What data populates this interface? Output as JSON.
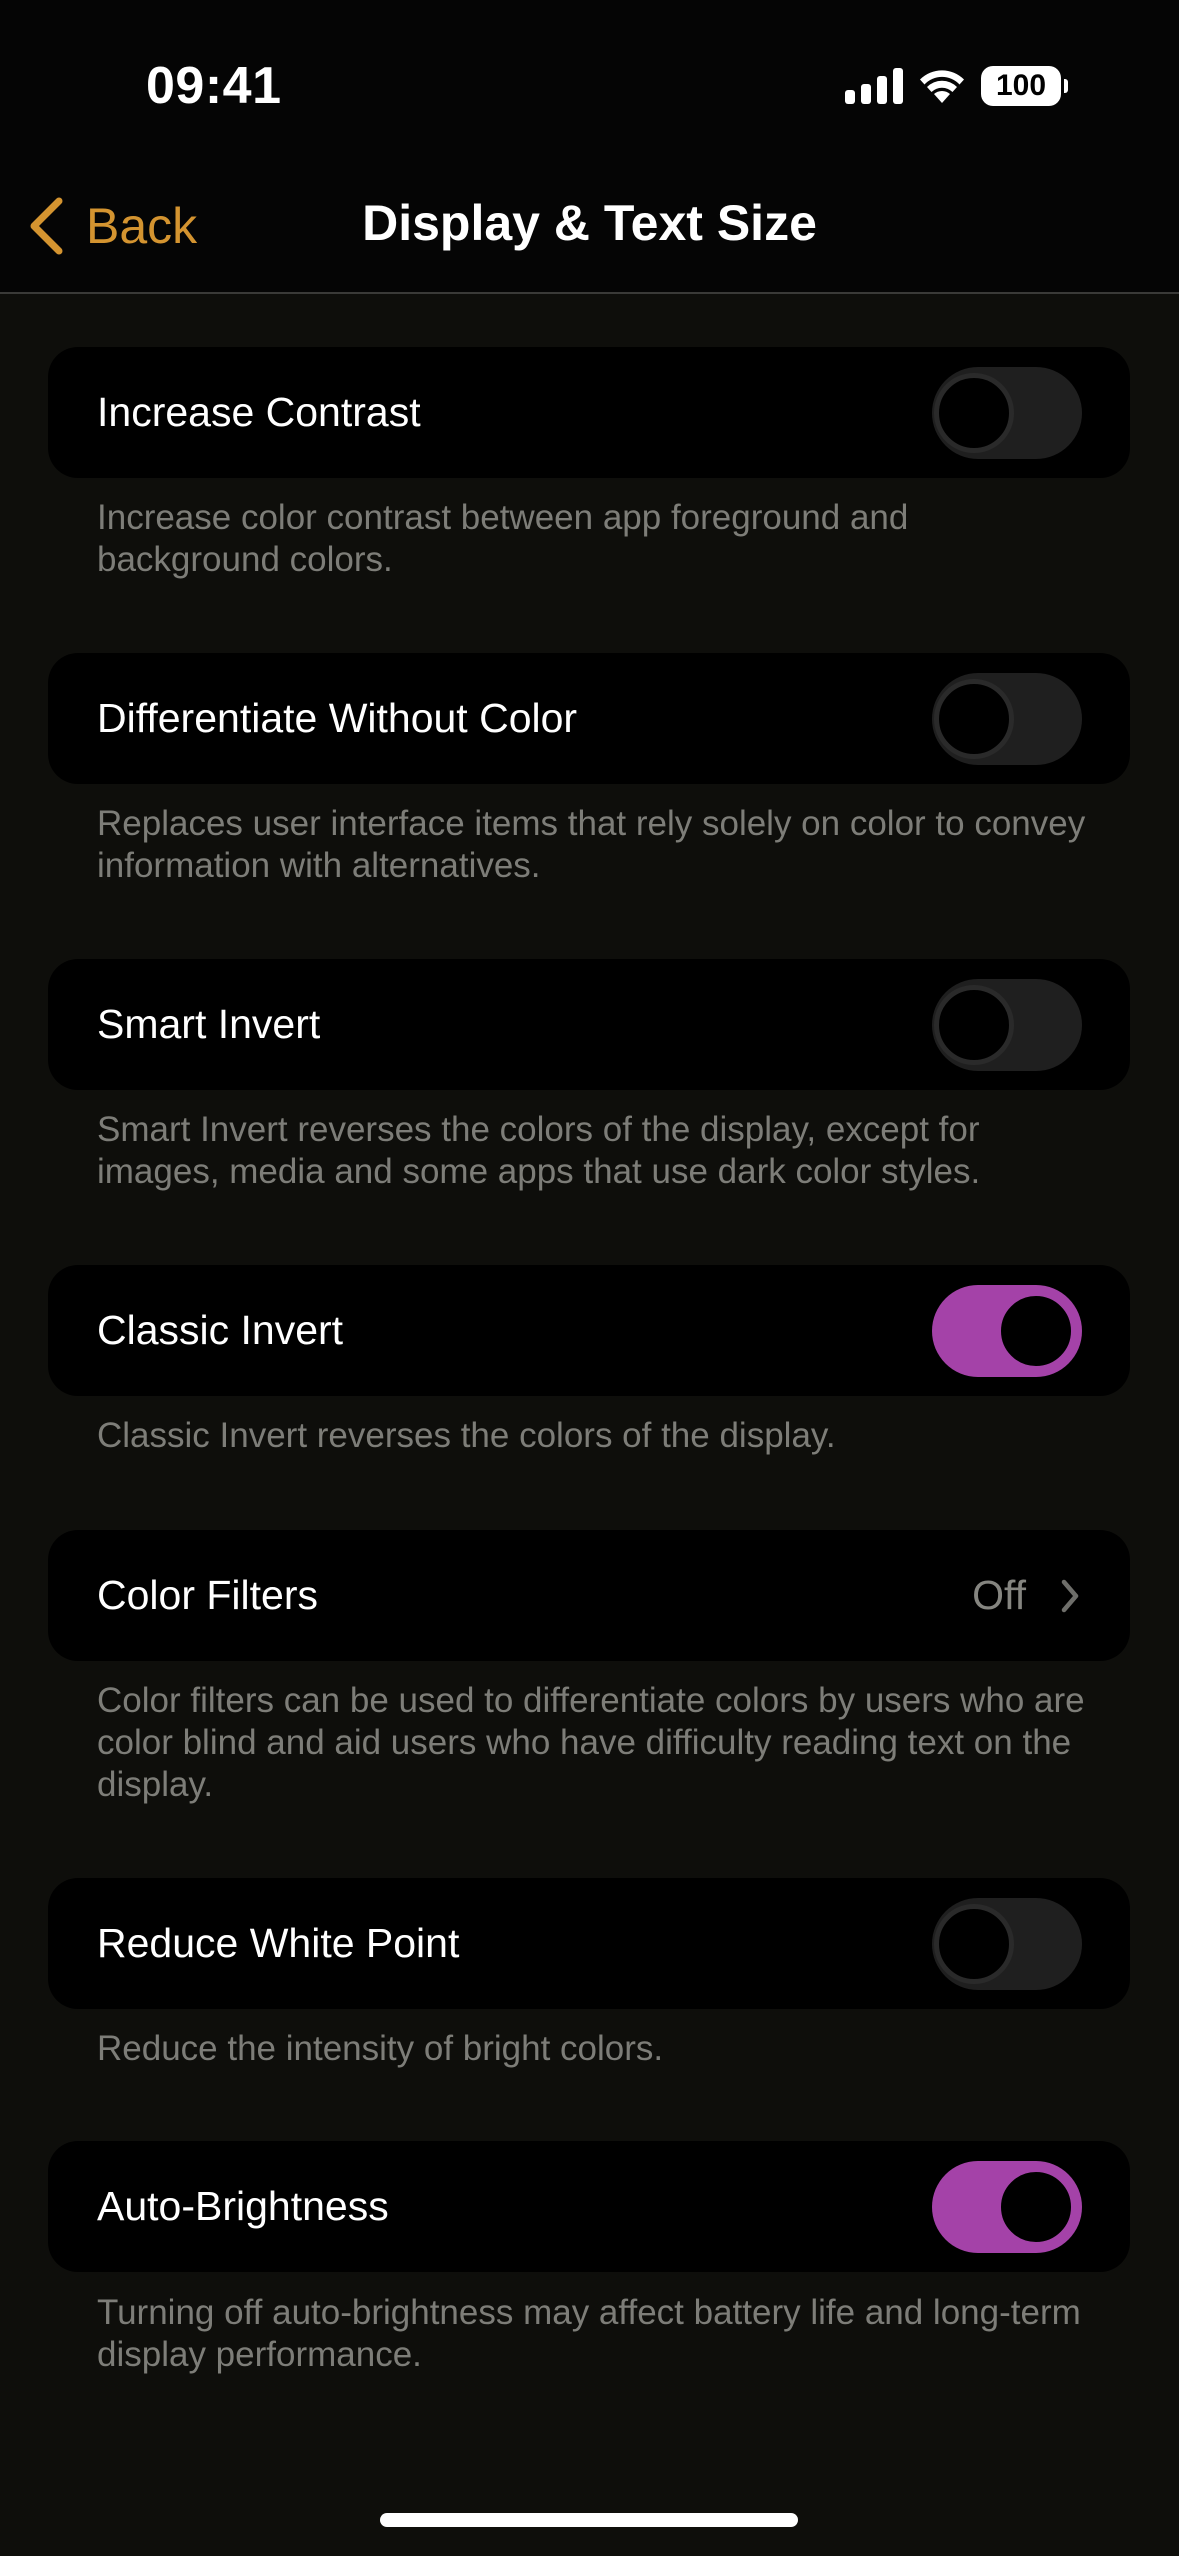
{
  "status_bar": {
    "time": "09:41",
    "battery_level": "100",
    "icons": [
      "cellular-signal-icon",
      "wifi-icon",
      "battery-icon"
    ]
  },
  "nav": {
    "back_label": "Back",
    "title": "Display & Text Size"
  },
  "colors": {
    "accent": "#d49430",
    "toggle_on": "#a442a8",
    "background": "#0e0e0b",
    "card": "#000000",
    "secondary_text": "#7d7d78"
  },
  "settings": [
    {
      "label": "Increase Contrast",
      "type": "toggle",
      "on": false,
      "footer": "Increase color contrast between app foreground and background colors."
    },
    {
      "label": "Differentiate Without Color",
      "type": "toggle",
      "on": false,
      "footer": "Replaces user interface items that rely solely on color to convey information with alternatives."
    },
    {
      "label": "Smart Invert",
      "type": "toggle",
      "on": false,
      "footer": "Smart Invert reverses the colors of the display, except for images, media and some apps that use dark color styles."
    },
    {
      "label": "Classic Invert",
      "type": "toggle",
      "on": true,
      "footer": "Classic Invert reverses the colors of the display."
    },
    {
      "label": "Color Filters",
      "type": "disclosure",
      "value": "Off",
      "footer": "Color filters can be used to differentiate colors by users who are color blind and aid users who have difficulty reading text on the display."
    },
    {
      "label": "Reduce White Point",
      "type": "toggle",
      "on": false,
      "footer": "Reduce the intensity of bright colors."
    },
    {
      "label": "Auto-Brightness",
      "type": "toggle",
      "on": true,
      "footer": "Turning off auto-brightness may affect battery life and long-term display performance."
    }
  ]
}
